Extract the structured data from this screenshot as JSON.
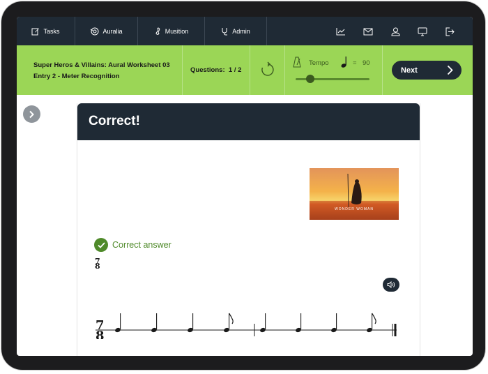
{
  "nav": {
    "tasks": "Tasks",
    "auralia": "Auralia",
    "musition": "Musition",
    "admin": "Admin"
  },
  "worksheet": {
    "title": "Super Heros & Villains: Aural Worksheet 03",
    "entry": "Entry 2 - Meter Recognition"
  },
  "questions": {
    "label": "Questions:",
    "progress": "1 / 2"
  },
  "tempo": {
    "label": "Tempo",
    "equals": "=",
    "value": "90",
    "slider_fraction": 0.2
  },
  "next_label": "Next",
  "card": {
    "title": "Correct!",
    "result": "Correct answer",
    "time_signature": {
      "top": "7",
      "bottom": "8"
    }
  },
  "poster": {
    "title": "WONDER WOMAN"
  },
  "colors": {
    "nav_bg": "#1f2a35",
    "accent_green": "#9bd656",
    "success_green": "#4f8a2a"
  }
}
